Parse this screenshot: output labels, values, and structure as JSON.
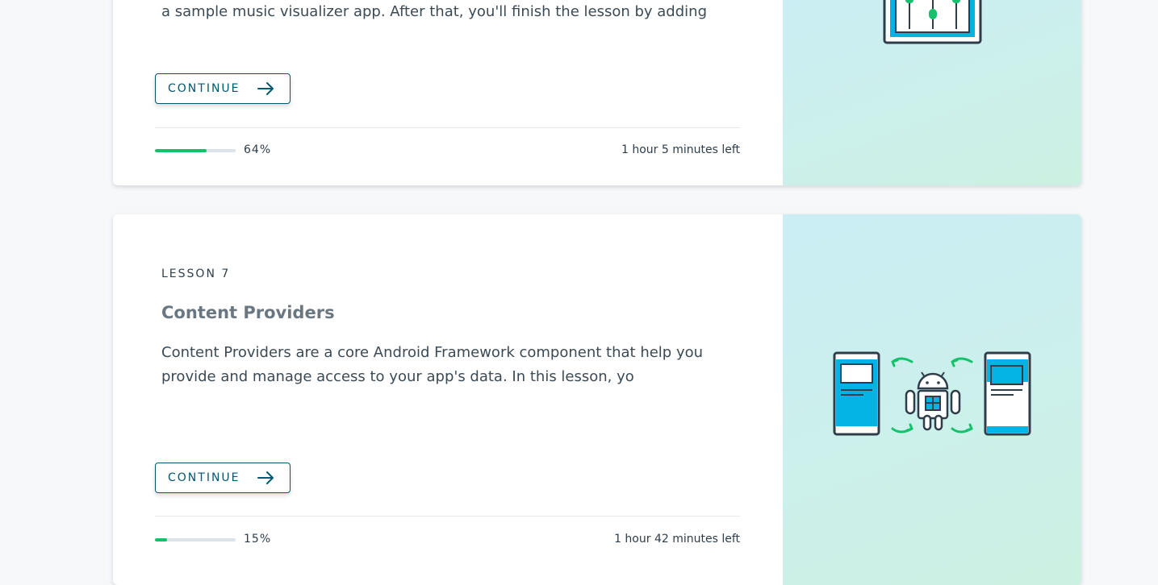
{
  "theme": {
    "progress_color": "#15c26b",
    "accent_blue": "#02b3e4",
    "button_color": "#02566e"
  },
  "lessons": [
    {
      "description": "a sample music visualizer app. After that, you'll finish the lesson by adding",
      "continue_label": "CONTINUE",
      "progress": 0.64,
      "progress_label": "64%",
      "time_left": "1 hour 5 minutes left",
      "illustration": "equalizer-sliders-icon"
    },
    {
      "lesson_label": "LESSON 7",
      "title": "Content Providers",
      "description": "Content Providers are a core Android Framework component that help you provide and manage access to your app's data. In this lesson, yo",
      "continue_label": "CONTINUE",
      "progress": 0.15,
      "progress_label": "15%",
      "time_left": "1 hour 42 minutes left",
      "illustration": "android-content-provider-icon"
    }
  ]
}
